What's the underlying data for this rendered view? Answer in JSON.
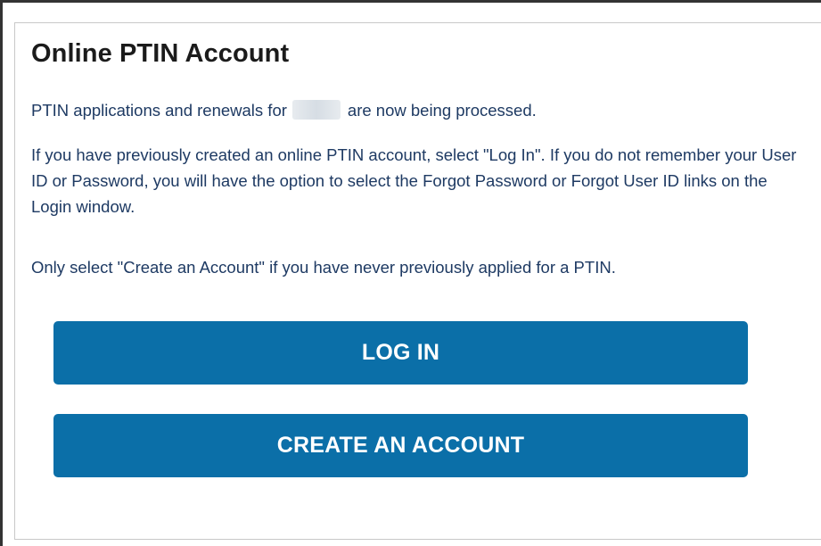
{
  "panel": {
    "title": "Online PTIN Account",
    "para1_prefix": "PTIN applications and renewals for",
    "para1_suffix": "are now being processed.",
    "para2": "If you have previously created an online PTIN account, select \"Log In\". If you do not remember your User ID or Password, you will have the option to select the Forgot Password or Forgot User ID links on the Login window.",
    "para3": "Only select \"Create an Account\" if you have never previously applied for a PTIN."
  },
  "buttons": {
    "login_label": "LOG IN",
    "create_label": "CREATE AN ACCOUNT"
  },
  "colors": {
    "button_bg": "#0b6fa8",
    "body_text": "#1e3a63",
    "title_text": "#1b1b1b"
  }
}
